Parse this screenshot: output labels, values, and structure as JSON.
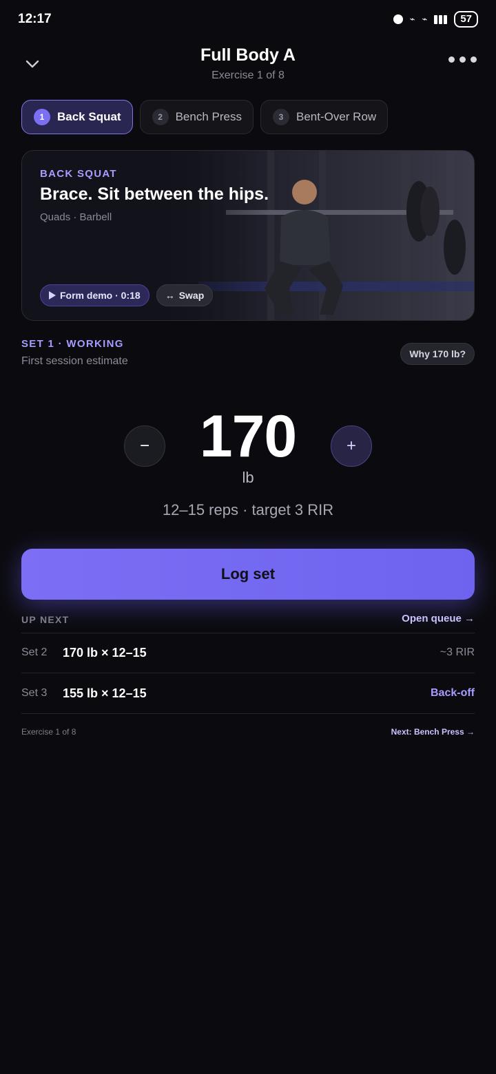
{
  "status_bar": {
    "time": "12:17",
    "battery": "57"
  },
  "header": {
    "title": "Full Body A",
    "subtitle": "Exercise 1 of 8"
  },
  "tabs": [
    {
      "num": "1",
      "label": "Back Squat"
    },
    {
      "num": "2",
      "label": "Bench Press"
    },
    {
      "num": "3",
      "label": "Bent-Over Row"
    }
  ],
  "hero": {
    "kicker": "BACK SQUAT",
    "headline": "Brace. Sit between the hips.",
    "meta": "Quads · Barbell",
    "demo_label": "Form demo · 0:18",
    "swap_label": "Swap"
  },
  "set": {
    "title": "SET 1 · WORKING",
    "subtitle": "First session estimate",
    "why_label": "Why 170 lb?",
    "weight": "170",
    "unit": "lb",
    "minus": "−",
    "plus": "+",
    "reps": "12–15 reps · target 3 RIR"
  },
  "log_button": "Log set",
  "up_next": {
    "heading": "UP NEXT",
    "open_queue": "Open queue →",
    "rows": [
      {
        "set": "Set 2",
        "value": "170 lb × 12–15",
        "note": "~3 RIR"
      },
      {
        "set": "Set 3",
        "value": "155 lb × 12–15",
        "note": "Back-off"
      }
    ]
  },
  "footer": {
    "progress": "Exercise 1 of 8",
    "next": "Next: Bench Press →"
  },
  "colors": {
    "accent": "#7c6ff5",
    "accent_text": "#a79cff",
    "background": "#0b0b0f"
  }
}
